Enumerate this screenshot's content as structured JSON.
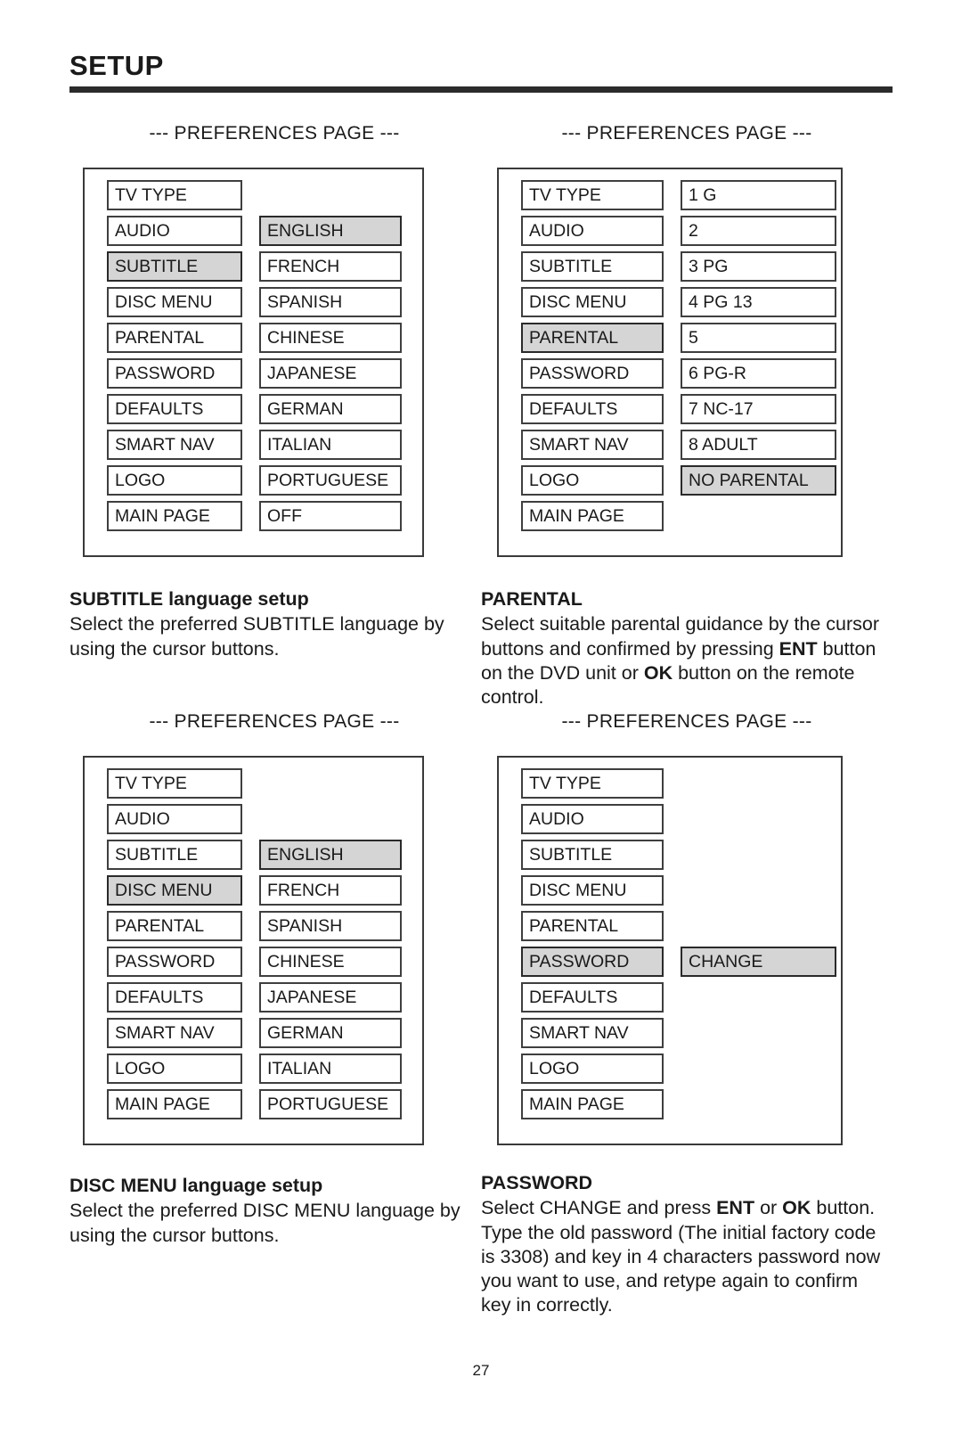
{
  "header": {
    "title": "SETUP"
  },
  "prefs_caption": "--- PREFERENCES PAGE ---",
  "colors": {
    "highlight": "#d5d5d5",
    "border": "#3f3f3f",
    "rule": "#2b2b2b",
    "text": "#1a1a1a"
  },
  "menu_labels": {
    "tv_type": "TV TYPE",
    "audio": "AUDIO",
    "subtitle": "SUBTITLE",
    "disc_menu": "DISC MENU",
    "parental": "PARENTAL",
    "password": "PASSWORD",
    "defaults": "DEFAULTS",
    "smart_nav": "SMART NAV",
    "logo": "LOGO",
    "main_page": "MAIN PAGE"
  },
  "panels": [
    {
      "id": "subtitle-panel",
      "caption": "--- PREFERENCES PAGE ---",
      "rows": [
        {
          "left": "TV TYPE",
          "left_hl": false,
          "right": "",
          "right_hl": false
        },
        {
          "left": "AUDIO",
          "left_hl": false,
          "right": "ENGLISH",
          "right_hl": true
        },
        {
          "left": "SUBTITLE",
          "left_hl": true,
          "right": "FRENCH",
          "right_hl": false
        },
        {
          "left": "DISC MENU",
          "left_hl": false,
          "right": "SPANISH",
          "right_hl": false
        },
        {
          "left": "PARENTAL",
          "left_hl": false,
          "right": "CHINESE",
          "right_hl": false
        },
        {
          "left": "PASSWORD",
          "left_hl": false,
          "right": "JAPANESE",
          "right_hl": false
        },
        {
          "left": "DEFAULTS",
          "left_hl": false,
          "right": "GERMAN",
          "right_hl": false
        },
        {
          "left": "SMART NAV",
          "left_hl": false,
          "right": "ITALIAN",
          "right_hl": false
        },
        {
          "left": "LOGO",
          "left_hl": false,
          "right": "PORTUGUESE",
          "right_hl": false
        },
        {
          "left": "MAIN PAGE",
          "left_hl": false,
          "right": "OFF",
          "right_hl": false
        }
      ]
    },
    {
      "id": "parental-panel",
      "caption": "--- PREFERENCES PAGE ---",
      "rows": [
        {
          "left": "TV TYPE",
          "left_hl": false,
          "right": "1 G",
          "right_hl": false
        },
        {
          "left": "AUDIO",
          "left_hl": false,
          "right": "2",
          "right_hl": false
        },
        {
          "left": "SUBTITLE",
          "left_hl": false,
          "right": "3 PG",
          "right_hl": false
        },
        {
          "left": "DISC MENU",
          "left_hl": false,
          "right": "4 PG 13",
          "right_hl": false
        },
        {
          "left": "PARENTAL",
          "left_hl": true,
          "right": "5",
          "right_hl": false
        },
        {
          "left": "PASSWORD",
          "left_hl": false,
          "right": "6 PG-R",
          "right_hl": false
        },
        {
          "left": "DEFAULTS",
          "left_hl": false,
          "right": "7 NC-17",
          "right_hl": false
        },
        {
          "left": "SMART NAV",
          "left_hl": false,
          "right": "8 ADULT",
          "right_hl": false
        },
        {
          "left": "LOGO",
          "left_hl": false,
          "right": "NO PARENTAL",
          "right_hl": true
        },
        {
          "left": "MAIN PAGE",
          "left_hl": false,
          "right": "",
          "right_hl": false
        }
      ]
    },
    {
      "id": "disc-menu-panel",
      "caption": "--- PREFERENCES PAGE ---",
      "rows": [
        {
          "left": "TV TYPE",
          "left_hl": false,
          "right": "",
          "right_hl": false
        },
        {
          "left": "AUDIO",
          "left_hl": false,
          "right": "",
          "right_hl": false
        },
        {
          "left": "SUBTITLE",
          "left_hl": false,
          "right": "ENGLISH",
          "right_hl": true
        },
        {
          "left": "DISC MENU",
          "left_hl": true,
          "right": "FRENCH",
          "right_hl": false
        },
        {
          "left": "PARENTAL",
          "left_hl": false,
          "right": "SPANISH",
          "right_hl": false
        },
        {
          "left": "PASSWORD",
          "left_hl": false,
          "right": "CHINESE",
          "right_hl": false
        },
        {
          "left": "DEFAULTS",
          "left_hl": false,
          "right": "JAPANESE",
          "right_hl": false
        },
        {
          "left": "SMART NAV",
          "left_hl": false,
          "right": "GERMAN",
          "right_hl": false
        },
        {
          "left": "LOGO",
          "left_hl": false,
          "right": "ITALIAN",
          "right_hl": false
        },
        {
          "left": "MAIN PAGE",
          "left_hl": false,
          "right": "PORTUGUESE",
          "right_hl": false
        }
      ]
    },
    {
      "id": "password-panel",
      "caption": "--- PREFERENCES PAGE ---",
      "rows": [
        {
          "left": "TV TYPE",
          "left_hl": false,
          "right": "",
          "right_hl": false
        },
        {
          "left": "AUDIO",
          "left_hl": false,
          "right": "",
          "right_hl": false
        },
        {
          "left": "SUBTITLE",
          "left_hl": false,
          "right": "",
          "right_hl": false
        },
        {
          "left": "DISC MENU",
          "left_hl": false,
          "right": "",
          "right_hl": false
        },
        {
          "left": "PARENTAL",
          "left_hl": false,
          "right": "",
          "right_hl": false
        },
        {
          "left": "PASSWORD",
          "left_hl": true,
          "right": "CHANGE",
          "right_hl": true
        },
        {
          "left": "DEFAULTS",
          "left_hl": false,
          "right": "",
          "right_hl": false
        },
        {
          "left": "SMART NAV",
          "left_hl": false,
          "right": "",
          "right_hl": false
        },
        {
          "left": "LOGO",
          "left_hl": false,
          "right": "",
          "right_hl": false
        },
        {
          "left": "MAIN PAGE",
          "left_hl": false,
          "right": "",
          "right_hl": false
        }
      ]
    }
  ],
  "sections": {
    "subtitle": {
      "heading": "SUBTITLE language setup",
      "body": "Select the preferred SUBTITLE language by using the cursor buttons."
    },
    "parental": {
      "heading": "PARENTAL",
      "body_part1": "Select suitable parental guidance by the cursor buttons and confirmed by pressing ",
      "bold1": "ENT",
      "body_part2": " button on the DVD unit or ",
      "bold2": "OK",
      "body_part3": " button on the remote control."
    },
    "disc_menu": {
      "heading": "DISC MENU language setup",
      "body": "Select the preferred DISC MENU language by using the cursor buttons."
    },
    "password": {
      "heading": "PASSWORD",
      "body_part1": "Select CHANGE and press ",
      "bold1": "ENT",
      "body_part2": " or ",
      "bold2": "OK",
      "body_part3": " button.  Type the old password (The initial factory code is 3308) and key in 4 characters password now you want to use, and retype again to confirm key in correctly."
    }
  },
  "footer": {
    "page_number": "27"
  }
}
